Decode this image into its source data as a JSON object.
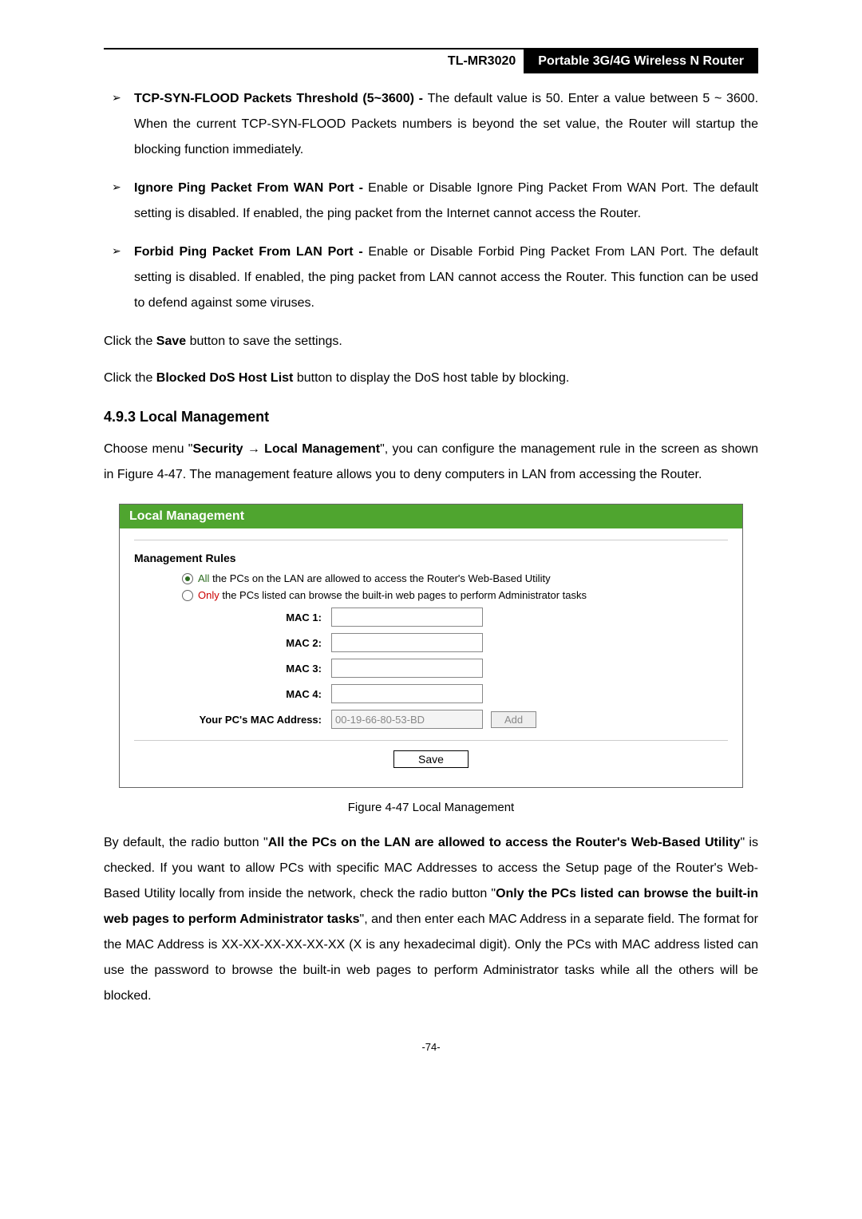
{
  "header": {
    "model": "TL-MR3020",
    "product": "Portable 3G/4G Wireless N Router"
  },
  "bullets": {
    "b1": {
      "title": "TCP-SYN-FLOOD Packets Threshold (5~3600) - ",
      "text": "The default value is 50. Enter a value between 5 ~ 3600. When the current TCP-SYN-FLOOD Packets numbers is beyond the set value, the Router will startup the blocking function immediately."
    },
    "b2": {
      "title": "Ignore Ping Packet From WAN Port - ",
      "text": "Enable or Disable Ignore Ping Packet From WAN Port. The default setting is disabled. If enabled, the ping packet from the Internet cannot access the Router."
    },
    "b3": {
      "title": "Forbid Ping Packet From LAN Port - ",
      "text": "Enable or Disable Forbid Ping Packet From LAN Port. The default setting is disabled. If enabled, the ping packet from LAN cannot access the Router. This function can be used to defend against some viruses."
    }
  },
  "para1_a": "Click the ",
  "para1_b": "Save",
  "para1_c": " button to save the settings.",
  "para2_a": "Click the ",
  "para2_b": "Blocked DoS Host List",
  "para2_c": " button to display the DoS host table by blocking.",
  "section": "4.9.3    Local Management",
  "intro_a": "Choose menu \"",
  "intro_b": "Security",
  "intro_c": "  →  ",
  "intro_d": "Local Management",
  "intro_e": "\", you can configure the management rule in the screen as shown in Figure 4-47. The management feature allows you to deny computers in LAN from accessing the Router.",
  "panel": {
    "title": "Local Management",
    "rules": "Management Rules",
    "opt_all_word": "All",
    "opt_all_rest": " the PCs on the LAN are allowed to access the Router's Web-Based Utility",
    "opt_only_word": "Only",
    "opt_only_rest": " the PCs listed can browse the built-in web pages to perform Administrator tasks",
    "mac1": "MAC 1:",
    "mac2": "MAC 2:",
    "mac3": "MAC 3:",
    "mac4": "MAC 4:",
    "yourmac": "Your PC's MAC Address:",
    "mac_value": "00-19-66-80-53-BD",
    "add": "Add",
    "save": "Save"
  },
  "caption": "Figure 4-47 Local Management",
  "tail_a": "By default, the radio button \"",
  "tail_b": "All the PCs on the LAN are allowed to access the Router's Web-Based Utility",
  "tail_c": "\" is checked. If you want to allow PCs with specific MAC Addresses to access the Setup page of the Router's Web-Based Utility locally from inside the network, check the radio button \"",
  "tail_d": "Only the PCs listed can browse the built-in web pages to perform Administrator tasks",
  "tail_e": "\", and then enter each MAC Address in a separate field. The format for the MAC Address is XX-XX-XX-XX-XX-XX (X is any hexadecimal digit). Only the PCs with MAC address listed can use the password to browse the built-in web pages to perform Administrator tasks while all the others will be blocked.",
  "page": "-74-"
}
